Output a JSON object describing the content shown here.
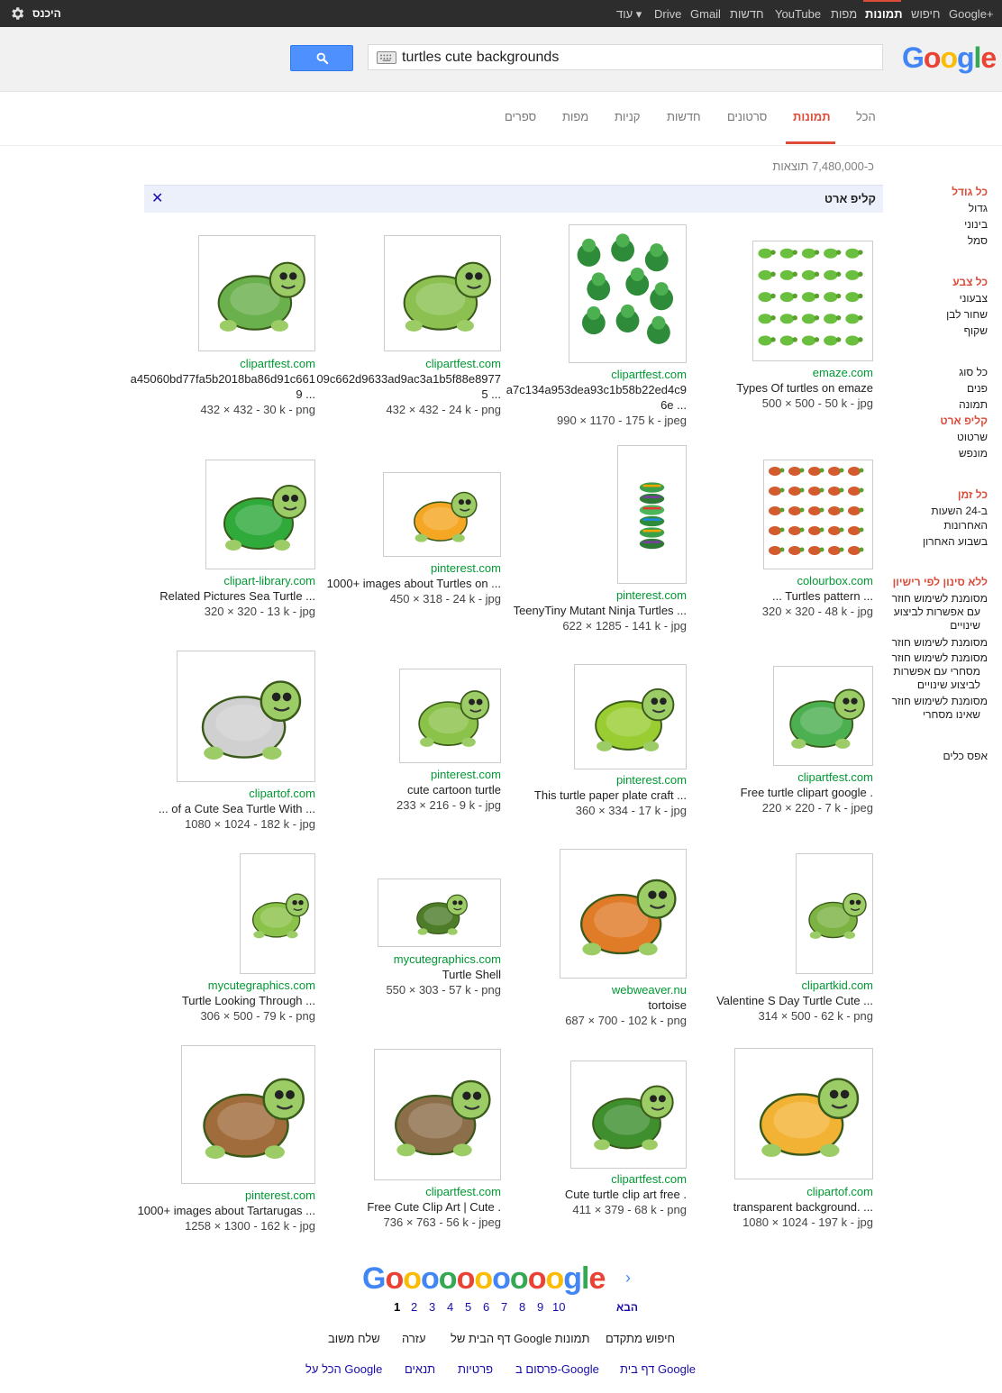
{
  "topbar": {
    "links": [
      "Google+",
      "חיפוש",
      "תמונות",
      "מפות",
      "YouTube",
      "חדשות",
      "Gmail",
      "Drive",
      "עוד ▾"
    ],
    "signin": "היכנס"
  },
  "search": {
    "query": "turtles cute backgrounds",
    "logo": "Google"
  },
  "tabs": [
    "הכל",
    "תמונות",
    "סרטונים",
    "חדשות",
    "קניות",
    "מפות",
    "ספרים"
  ],
  "results_count": "כ-7,480,000 תוצאות",
  "filter": {
    "label": "קליפ ארט",
    "close": "✕"
  },
  "sidebar": {
    "size_header": "כל גודל",
    "size_items": [
      "גדול",
      "בינוני",
      "סמל"
    ],
    "color_header": "כל צבע",
    "color_items": [
      "צבעוני",
      "שחור לבן",
      "שקוף"
    ],
    "type_header": "כל סוג",
    "type_items": [
      "פנים",
      "תמונה"
    ],
    "type_selected": "קליפ ארט",
    "type_items2": [
      "שרטוט",
      "מונפש"
    ],
    "time_header": "כל זמן",
    "time_items": [
      "ב-24 השעות",
      "האחרונות",
      "בשבוע האחרון"
    ],
    "license_header": "ללא סינון לפי רישיון",
    "license_items": [
      "מסומנת לשימוש חוזר",
      "עם אפשרות לביצוע",
      "שינויים",
      "מסומנת לשימוש חוזר",
      "מסומנת לשימוש חוזר",
      "מסחרי עם אפשרות",
      "לביצוע שינויים",
      "מסומנת לשימוש חוזר",
      "שאינו מסחרי"
    ],
    "reset": "אפס כלים"
  },
  "results": [
    {
      "src": "emaze.com",
      "title": "Types Of turtles on emaze",
      "meta": "500 × 500 - 50 k - jpg"
    },
    {
      "src": "clipartfest.com",
      "title": "a7c134a953dea93c1b58b22ed4c9",
      "title2": "6e ...",
      "meta": "990 × 1170 - 175 k - jpeg"
    },
    {
      "src": "clipartfest.com",
      "title": "09c662d9633ad9ac3a1b5f88e8977",
      "title2": "5 ...",
      "meta": "432 × 432 - 24 k - png"
    },
    {
      "src": "clipartfest.com",
      "title": "a45060bd77fa5b2018ba86d91c661",
      "title2": "9 ...",
      "meta": "432 × 432 - 30 k - png"
    },
    {
      "src": "colourbox.com",
      "title": "... Turtles pattern ...",
      "meta": "320 × 320 - 48 k - jpg"
    },
    {
      "src": "pinterest.com",
      "title": "TeenyTiny Mutant Ninja Turtles ...",
      "meta": "622 × 1285 - 141 k - jpg"
    },
    {
      "src": "pinterest.com",
      "title": "1000+ images about Turtles on ...",
      "meta": "450 × 318 - 24 k - jpg"
    },
    {
      "src": "clipart-library.com",
      "title": "Related Pictures Sea Turtle ...",
      "meta": "320 × 320 - 13 k - jpg"
    },
    {
      "src": "clipartfest.com",
      "title": "Free turtle clipart google .",
      "meta": "220 × 220 - 7 k - jpeg"
    },
    {
      "src": "pinterest.com",
      "title": "This turtle paper plate craft ...",
      "meta": "360 × 334 - 17 k - jpg"
    },
    {
      "src": "pinterest.com",
      "title": "cute cartoon turtle",
      "meta": "233 × 216 - 9 k - jpg"
    },
    {
      "src": "clipartof.com",
      "title": "... of a Cute Sea Turtle With ...",
      "meta": "1080 × 1024 - 182 k - jpg"
    },
    {
      "src": "clipartkid.com",
      "title": "Valentine S Day Turtle Cute ...",
      "meta": "314 × 500 - 62 k - png"
    },
    {
      "src": "webweaver.nu",
      "title": "tortoise",
      "meta": "687 × 700 - 102 k - png"
    },
    {
      "src": "mycutegraphics.com",
      "title": "Turtle Shell",
      "meta": "550 × 303 - 57 k - png"
    },
    {
      "src": "mycutegraphics.com",
      "title": "Turtle Looking Through ...",
      "meta": "306 × 500 - 79 k - png"
    },
    {
      "src": "clipartof.com",
      "title": "transparent background. ...",
      "meta": "1080 × 1024 - 197 k - jpg"
    },
    {
      "src": "clipartfest.com",
      "title": "Cute turtle clip art free .",
      "meta": "411 × 379 - 68 k - png"
    },
    {
      "src": "clipartfest.com",
      "title": "Free Cute Clip Art | Cute .",
      "meta": "736 × 763 - 56 k - jpeg"
    },
    {
      "src": "pinterest.com",
      "title": "1000+ images about Tartarugas ...",
      "meta": "1258 × 1300 - 162 k - jpg"
    }
  ],
  "pager": {
    "logo": "Goooooooooogle",
    "pages": [
      "1",
      "2",
      "3",
      "4",
      "5",
      "6",
      "7",
      "8",
      "9",
      "10"
    ],
    "next": "הבא"
  },
  "footer": {
    "row1": [
      "חיפוש מתקדם",
      "דף הבית של Google תמונות",
      "עזרה",
      "שלח משוב"
    ],
    "row2": [
      "דף בית Google",
      "פרסום ב-Google",
      "פרטיות",
      "תנאים",
      "הכל על Google"
    ]
  },
  "colors": {
    "accent": "#dd4b39",
    "link": "#1a0dab",
    "url": "#009933",
    "search_btn": "#4d90fe"
  }
}
